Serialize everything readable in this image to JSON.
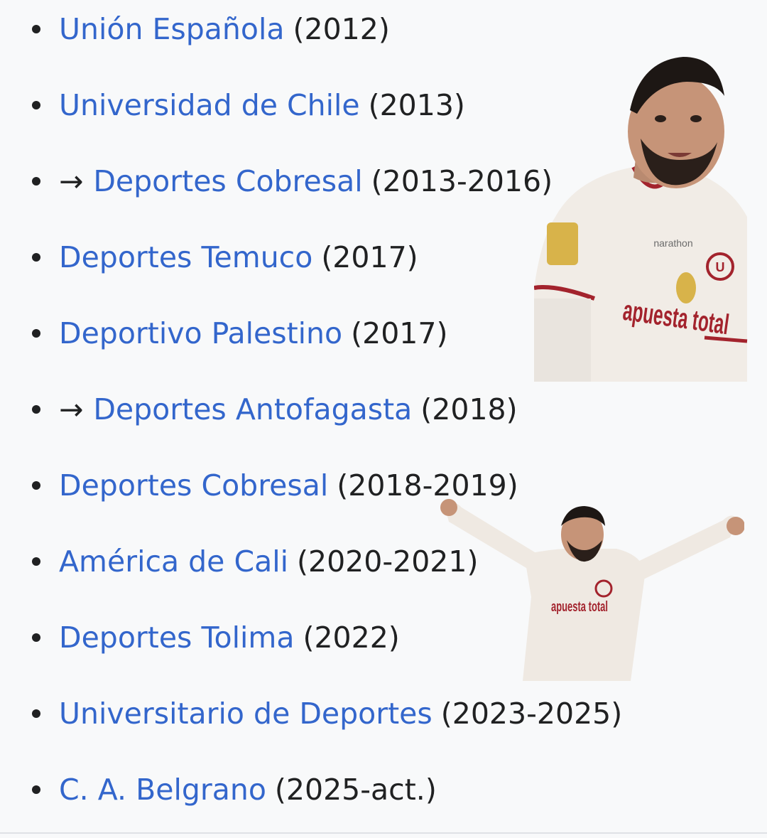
{
  "clubs": [
    {
      "arrow": "",
      "name": "Unión Española",
      "years": "(2012)"
    },
    {
      "arrow": "",
      "name": "Universidad de Chile",
      "years": "(2013)"
    },
    {
      "arrow": "→",
      "name": "Deportes Cobresal",
      "years": "(2013-2016)"
    },
    {
      "arrow": "",
      "name": "Deportes Temuco",
      "years": "(2017)"
    },
    {
      "arrow": "",
      "name": "Deportivo Palestino",
      "years": "(2017)"
    },
    {
      "arrow": "→",
      "name": "Deportes Antofagasta",
      "years": "(2018)"
    },
    {
      "arrow": "",
      "name": "Deportes Cobresal",
      "years": "(2018-2019)"
    },
    {
      "arrow": "",
      "name": "América de Cali",
      "years": "(2020-2021)"
    },
    {
      "arrow": "",
      "name": "Deportes Tolima",
      "years": "(2022)"
    },
    {
      "arrow": "",
      "name": "Universitario de Deportes",
      "years": "(2023-2025)"
    },
    {
      "arrow": "",
      "name": "C. A. Belgrano",
      "years": "(2025-act.)"
    }
  ],
  "photos": {
    "top": {
      "shirt_sponsor": "apuesta total",
      "shirt_maker": "narathon"
    },
    "bottom": {
      "shirt_sponsor": "apuesta total"
    }
  },
  "colors": {
    "link": "#3366cc",
    "text": "#202122",
    "background": "#f8f9fa"
  }
}
